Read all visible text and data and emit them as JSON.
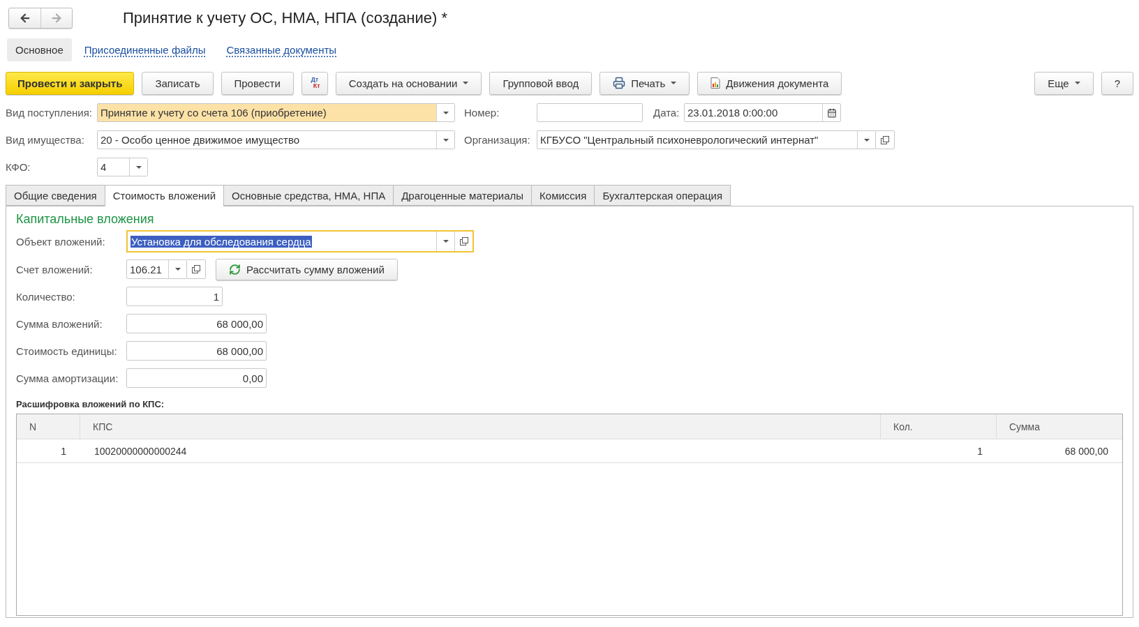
{
  "window": {
    "title": "Принятие к учету ОС, НМА, НПА (создание) *"
  },
  "sections": [
    {
      "label": "Основное",
      "selected": true
    },
    {
      "label": "Присоединенные файлы",
      "selected": false
    },
    {
      "label": "Связанные документы",
      "selected": false
    }
  ],
  "toolbar": {
    "left": [
      {
        "kind": "primary",
        "label": "Провести и закрыть"
      },
      {
        "kind": "plain",
        "label": "Записать"
      },
      {
        "kind": "plain",
        "label": "Провести"
      },
      {
        "kind": "dtkt",
        "top": "Дт",
        "bottom": "Кт"
      },
      {
        "kind": "menu",
        "label": "Создать на основании"
      },
      {
        "kind": "plain",
        "label": "Групповой ввод"
      },
      {
        "kind": "print",
        "label": "Печать"
      },
      {
        "kind": "report",
        "label": "Движения документа"
      }
    ],
    "right": [
      {
        "kind": "menu",
        "label": "Еще"
      },
      {
        "kind": "plain",
        "label": "?"
      }
    ]
  },
  "header": [
    {
      "fields": [
        {
          "label": "Вид поступления:",
          "kind": "combo",
          "value": "Принятие к учету со счета 106 (приобретение)",
          "highlighted": true
        },
        {
          "label": "Номер:",
          "kind": "input"
        },
        {
          "label": "Дата:",
          "kind": "date",
          "value": "23.01.2018  0:00:00"
        }
      ]
    },
    {
      "fields": [
        {
          "label": "Вид имущества:",
          "kind": "combo",
          "value": "20 - Особо ценное движимое имущество"
        },
        {
          "label": "Организация:",
          "kind": "combo",
          "value": "КГБУСО \"Центральный психоневрологический интернат\"",
          "open_button": true
        }
      ]
    },
    {
      "fields": [
        {
          "label": "КФО:",
          "kind": "small",
          "value": "4"
        }
      ]
    }
  ],
  "tabs": [
    {
      "label": "Общие сведения",
      "selected": false
    },
    {
      "label": "Стоимость вложений",
      "selected": true
    },
    {
      "label": "Основные средства, НМА, НПА",
      "selected": false
    },
    {
      "label": "Драгоценные материалы",
      "selected": false
    },
    {
      "label": "Комиссия",
      "selected": false
    },
    {
      "label": "Бухгалтерская операция",
      "selected": false
    }
  ],
  "panel": {
    "group_title": "Капитальные вложения",
    "fields": [
      {
        "label": "Объект вложений:",
        "kind": "object",
        "value": "Установка для обследования сердца",
        "focused": true
      },
      {
        "label": "Счет вложений:",
        "kind": "account",
        "value": "106.21",
        "button": "Рассчитать сумму вложений"
      },
      {
        "label": "Количество:",
        "kind": "count",
        "value": "1"
      },
      {
        "label": "Сумма вложений:",
        "kind": "number",
        "value": "68 000,00"
      },
      {
        "label": "Стоимость единицы:",
        "kind": "number",
        "value": "68 000,00"
      },
      {
        "label": "Сумма амортизации:",
        "kind": "number",
        "value": "0,00"
      }
    ],
    "table_title": "Расшифровка вложений по КПС:",
    "table": {
      "columns": [
        "N",
        "КПС",
        "Кол.",
        "Сумма"
      ],
      "rows": [
        [
          "1",
          "10020000000000244",
          "1",
          "68 000,00"
        ]
      ]
    }
  }
}
